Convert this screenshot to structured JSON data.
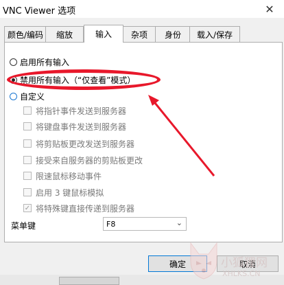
{
  "window": {
    "title": "VNC Viewer 选项",
    "close_glyph": "✕"
  },
  "tabs": [
    {
      "label": "颜色/编码",
      "active": false
    },
    {
      "label": "缩放",
      "active": false
    },
    {
      "label": "输入",
      "active": true
    },
    {
      "label": "杂项",
      "active": false
    },
    {
      "label": "身份",
      "active": false
    },
    {
      "label": "载入/保存",
      "active": false
    }
  ],
  "input_mode": {
    "options": [
      {
        "label": "启用所有输入",
        "checked": false
      },
      {
        "label": "禁用所有输入（“仅查看”模式）",
        "checked": true
      },
      {
        "label": "自定义",
        "checked": false
      }
    ]
  },
  "custom_options": [
    {
      "label": "将指针事件发送到服务器",
      "checked": false
    },
    {
      "label": "将键盘事件发送到服务器",
      "checked": false
    },
    {
      "label": "将剪贴板更改发送到服务器",
      "checked": false
    },
    {
      "label": "接受来自服务器的剪贴板更改",
      "checked": false
    },
    {
      "label": "限速鼠标移动事件",
      "checked": false
    },
    {
      "label": "启用 3 键鼠标模拟",
      "checked": false
    },
    {
      "label": "将特殊键直接传递到服务器",
      "checked": true
    }
  ],
  "menu_key": {
    "label": "菜单键",
    "value": "F8"
  },
  "buttons": {
    "ok": "确定",
    "cancel": "取消"
  },
  "annotation": {
    "color": "#e8182b"
  },
  "watermark": {
    "cn": "小狐狸网",
    "en": "XHLKS.CN"
  }
}
